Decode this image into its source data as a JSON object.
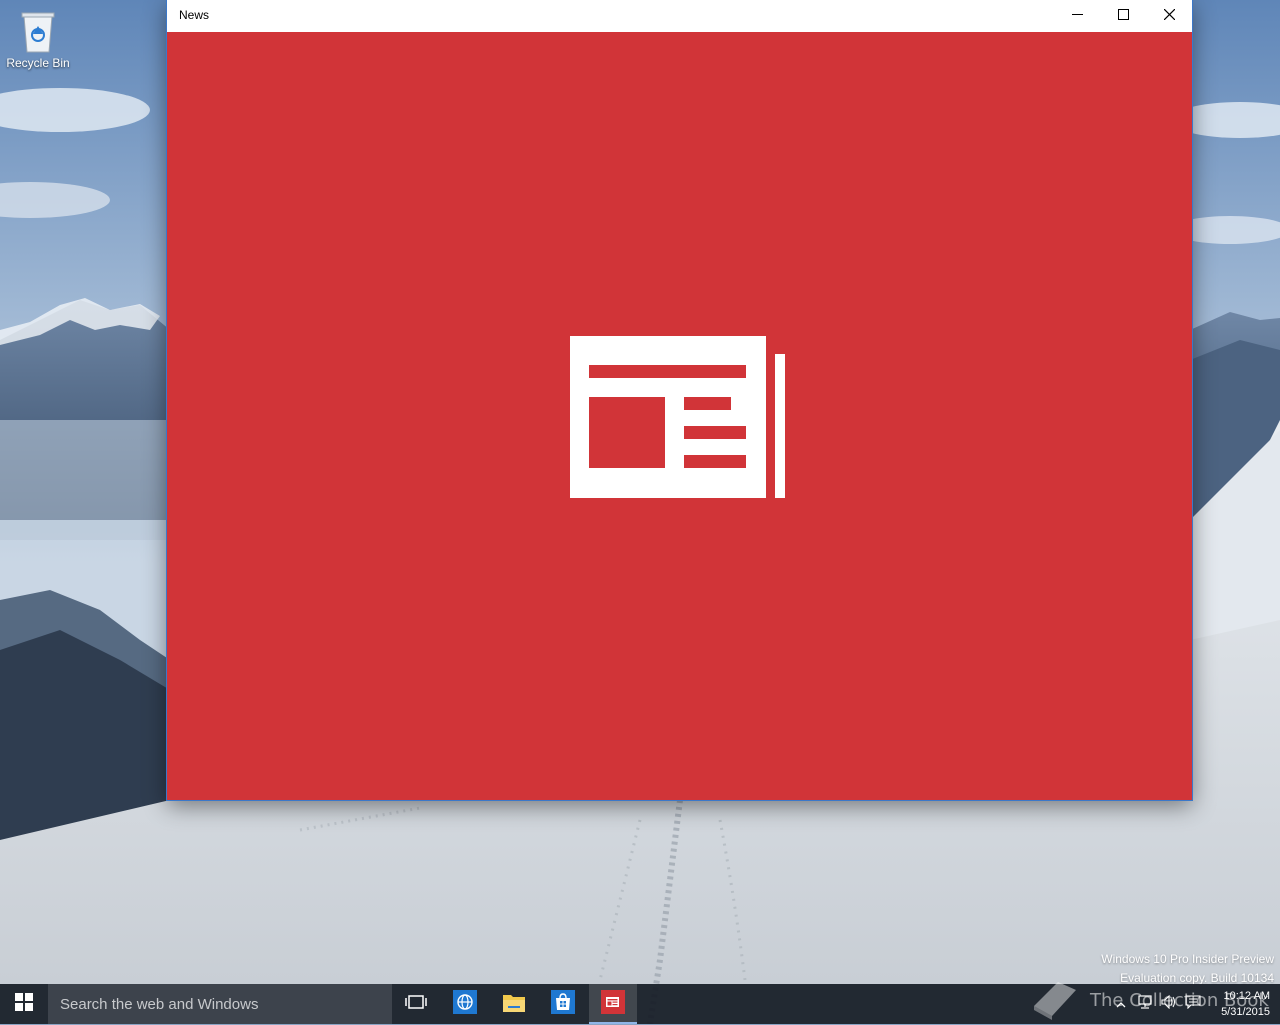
{
  "desktop": {
    "icons": [
      {
        "label": "Recycle Bin",
        "icon": "recycle-bin-icon"
      }
    ],
    "watermark": {
      "line1": "Windows 10 Pro Insider Preview",
      "line2": "Evaluation copy. Build 10134"
    }
  },
  "window": {
    "title": "News",
    "controls": {
      "minimize": "minimize-icon",
      "maximize": "maximize-icon",
      "close": "close-icon"
    },
    "splash_color": "#d13438",
    "splash_icon": "newspaper-icon"
  },
  "taskbar": {
    "start_icon": "windows-logo-icon",
    "search_placeholder": "Search the web and Windows",
    "pinned": [
      {
        "name": "task-view",
        "icon": "task-view-icon"
      },
      {
        "name": "edge",
        "icon": "globe-icon"
      },
      {
        "name": "file-explorer",
        "icon": "folder-icon"
      },
      {
        "name": "store",
        "icon": "store-icon"
      },
      {
        "name": "news",
        "icon": "news-icon",
        "active": true
      }
    ],
    "tray": {
      "icons": [
        "chevron-up-icon",
        "network-icon",
        "volume-icon",
        "action-center-icon"
      ],
      "time": "10:12 AM",
      "date": "5/31/2015"
    },
    "brand_overlay": "The Collection Book"
  },
  "colors": {
    "accent": "#d13438",
    "taskbar": "#161c26",
    "search_box": "#3d434c"
  }
}
